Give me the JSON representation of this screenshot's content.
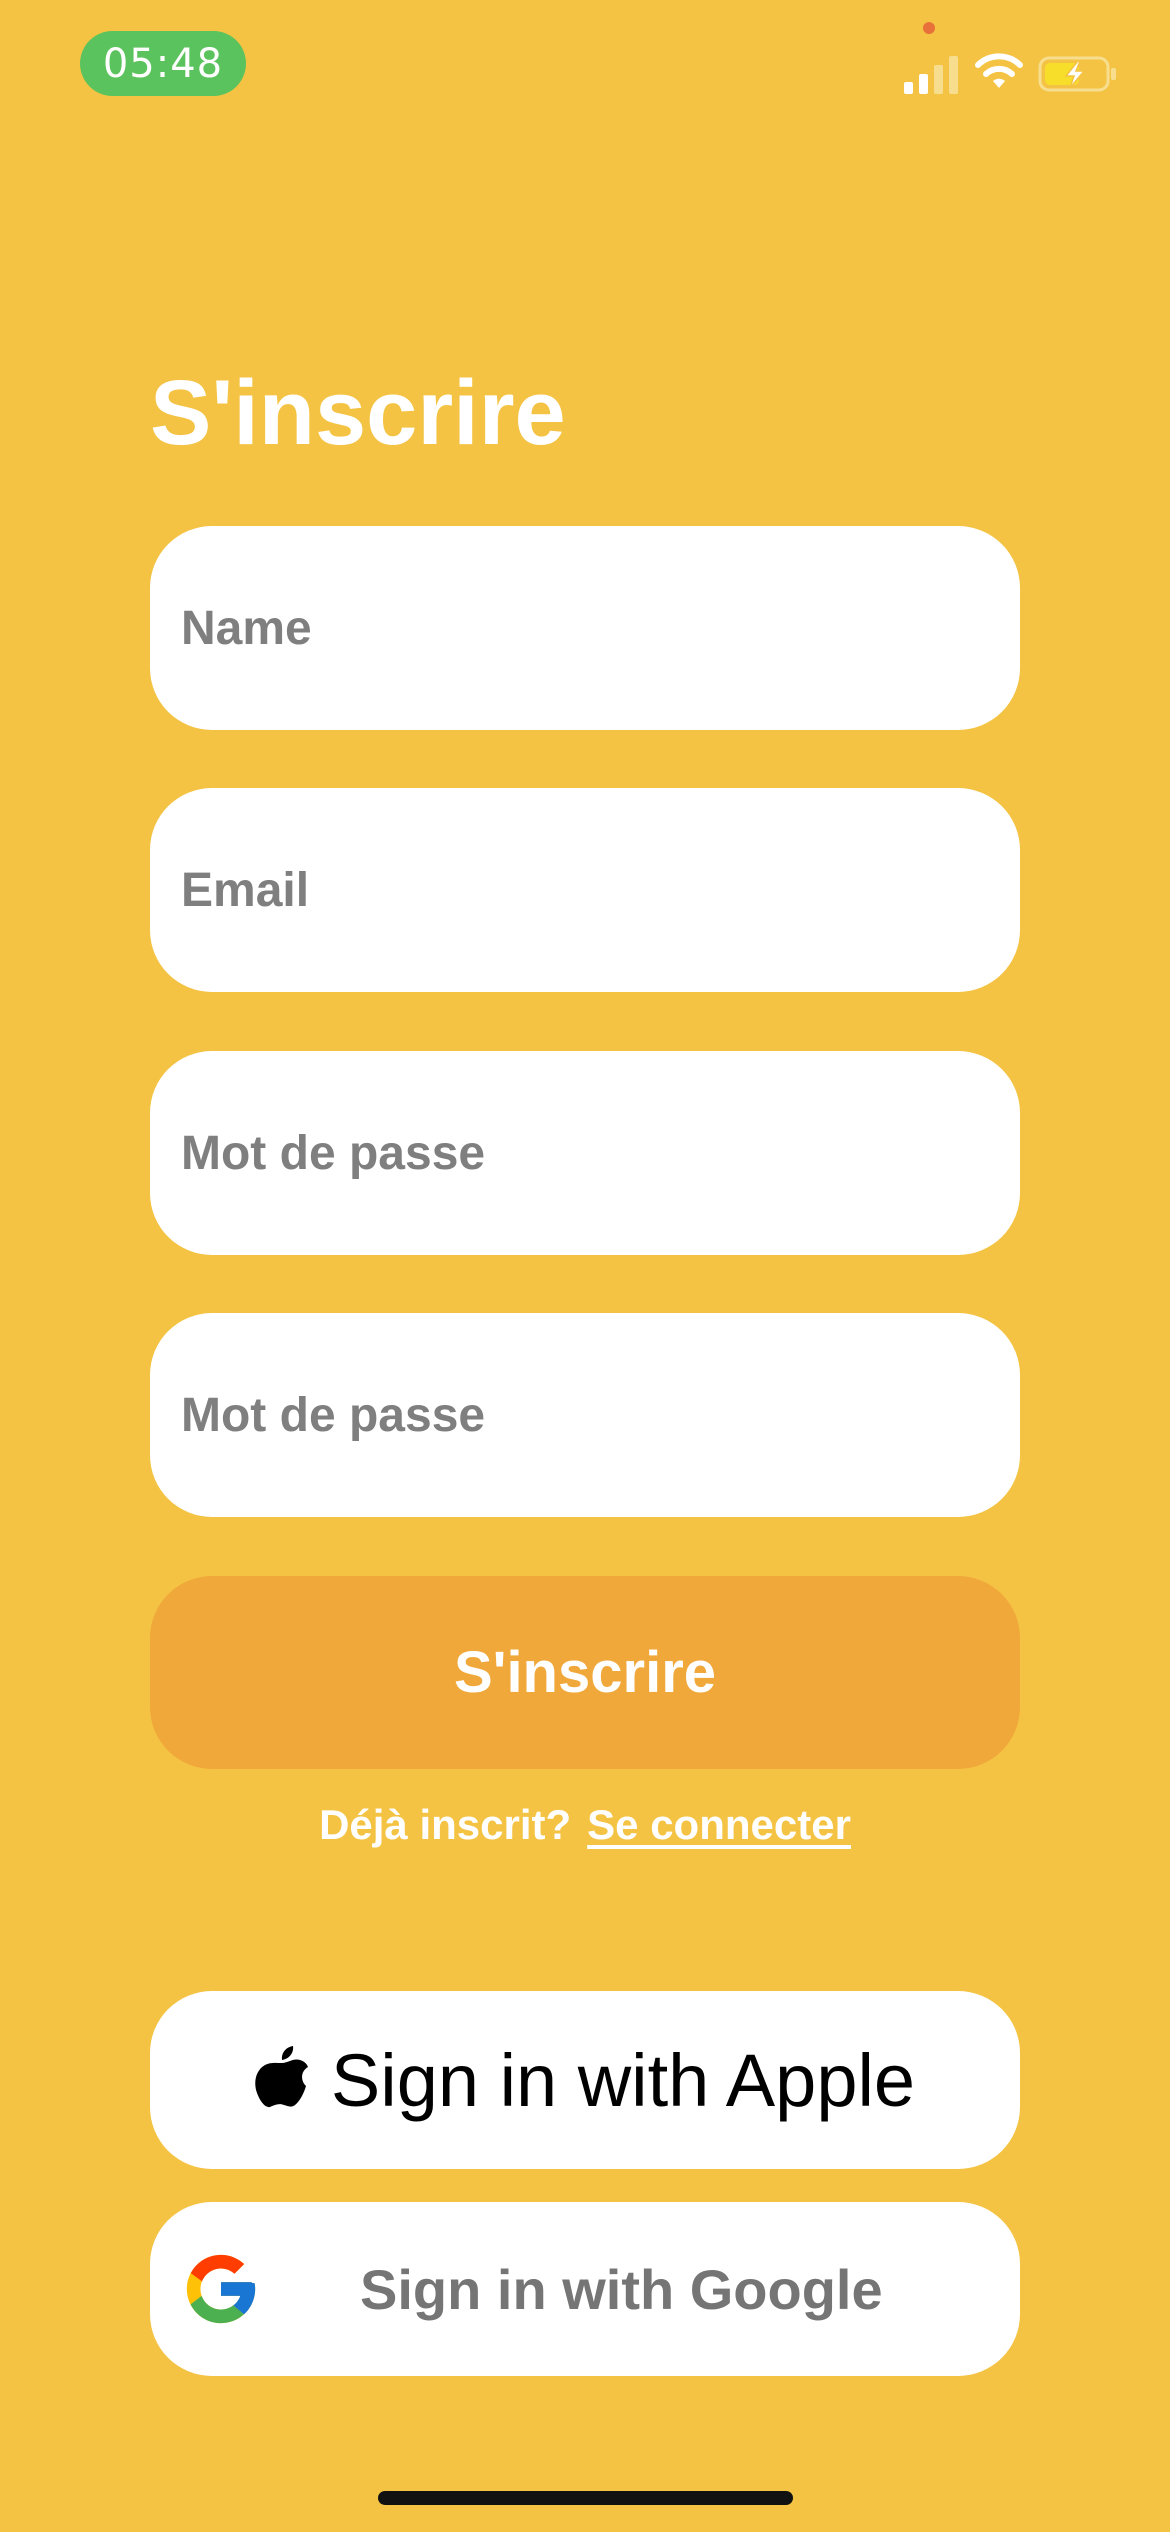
{
  "status_bar": {
    "time": "05:48",
    "signal_icon": "cellular-signal-icon",
    "wifi_icon": "wifi-icon",
    "battery_icon": "battery-charging-icon"
  },
  "form": {
    "title": "S'inscrire",
    "fields": [
      {
        "placeholder": "Name",
        "value": ""
      },
      {
        "placeholder": "Email",
        "value": ""
      },
      {
        "placeholder": "Mot de passe",
        "value": ""
      },
      {
        "placeholder": "Mot de passe",
        "value": ""
      }
    ],
    "submit_label": "S'inscrire",
    "already_registered_text": "Déjà inscrit?",
    "login_link_label": "Se connecter"
  },
  "social": {
    "apple_label": "Sign in with Apple",
    "google_label": "Sign in with Google"
  },
  "colors": {
    "background": "#F4C343",
    "primary_button": "#F0A83A",
    "time_pill": "#5BC35E",
    "placeholder": "#7F7F7F"
  }
}
